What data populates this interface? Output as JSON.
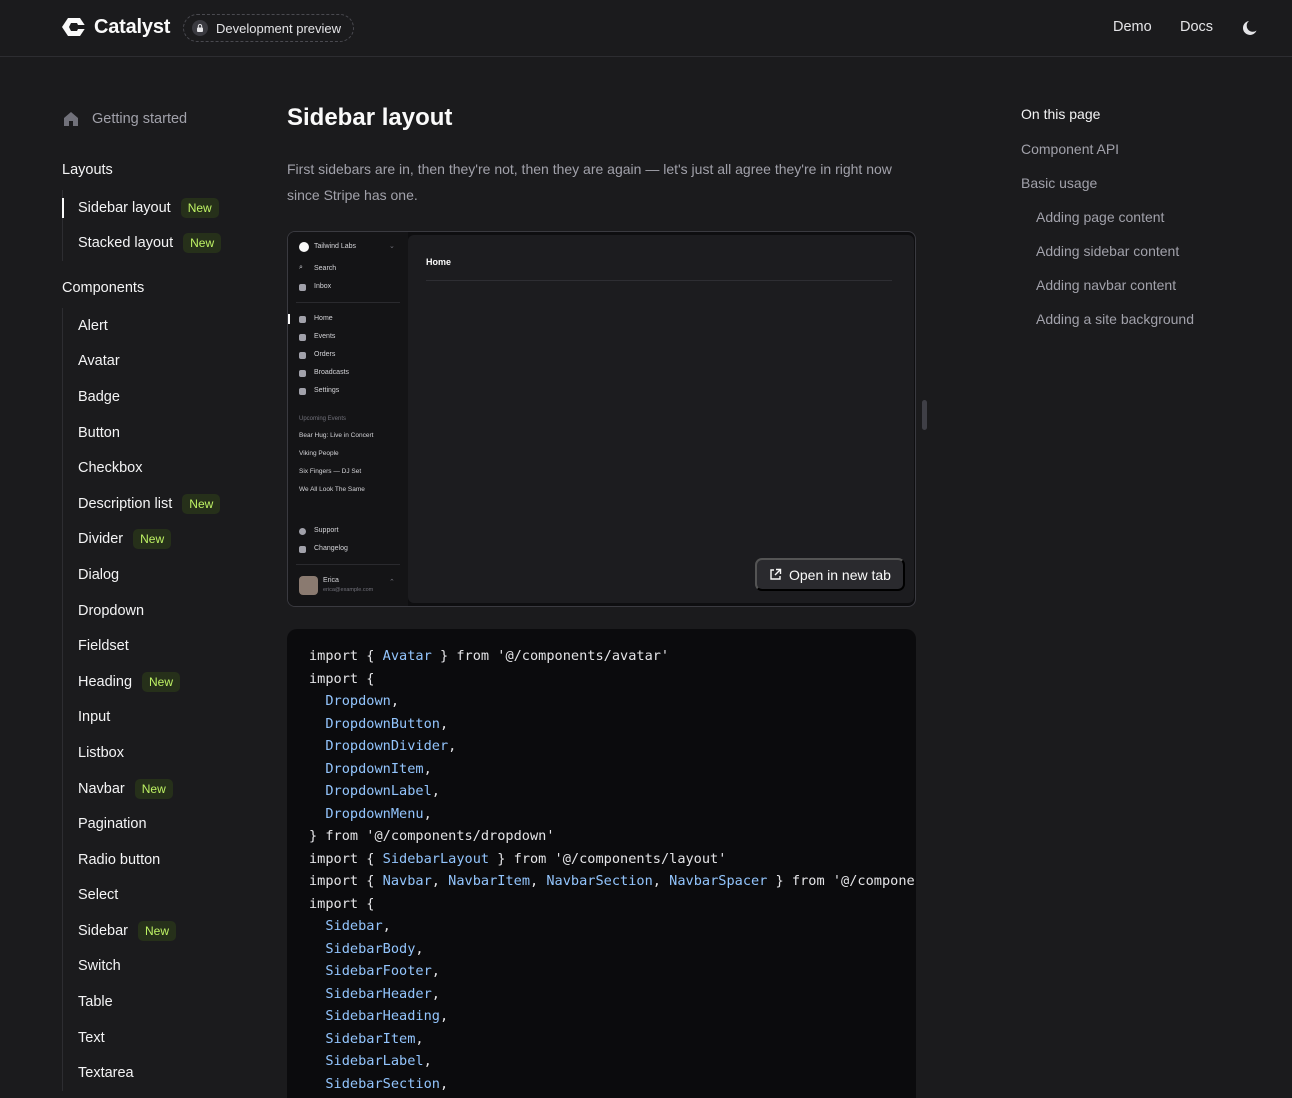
{
  "header": {
    "brand": "Catalyst",
    "pill": "Development preview",
    "links": [
      "Demo",
      "Docs"
    ]
  },
  "sidebar": {
    "getting_started": "Getting started",
    "layouts_heading": "Layouts",
    "layouts": [
      {
        "label": "Sidebar layout",
        "badge": "New"
      },
      {
        "label": "Stacked layout",
        "badge": "New"
      }
    ],
    "components_heading": "Components",
    "components": [
      {
        "label": "Alert",
        "badge": ""
      },
      {
        "label": "Avatar",
        "badge": ""
      },
      {
        "label": "Badge",
        "badge": ""
      },
      {
        "label": "Button",
        "badge": ""
      },
      {
        "label": "Checkbox",
        "badge": ""
      },
      {
        "label": "Description list",
        "badge": "New"
      },
      {
        "label": "Divider",
        "badge": "New"
      },
      {
        "label": "Dialog",
        "badge": ""
      },
      {
        "label": "Dropdown",
        "badge": ""
      },
      {
        "label": "Fieldset",
        "badge": ""
      },
      {
        "label": "Heading",
        "badge": "New"
      },
      {
        "label": "Input",
        "badge": ""
      },
      {
        "label": "Listbox",
        "badge": ""
      },
      {
        "label": "Navbar",
        "badge": "New"
      },
      {
        "label": "Pagination",
        "badge": ""
      },
      {
        "label": "Radio button",
        "badge": ""
      },
      {
        "label": "Select",
        "badge": ""
      },
      {
        "label": "Sidebar",
        "badge": "New"
      },
      {
        "label": "Switch",
        "badge": ""
      },
      {
        "label": "Table",
        "badge": ""
      },
      {
        "label": "Text",
        "badge": ""
      },
      {
        "label": "Textarea",
        "badge": ""
      }
    ]
  },
  "main": {
    "title": "Sidebar layout",
    "lead": "First sidebars are in, then they're not, then they are again — let's just all agree they're in right now since Stripe has one.",
    "open_tab": "Open in new tab"
  },
  "preview": {
    "team": "Tailwind Labs",
    "search": "Search",
    "inbox": "Inbox",
    "nav": [
      "Home",
      "Events",
      "Orders",
      "Broadcasts",
      "Settings"
    ],
    "upcoming_heading": "Upcoming Events",
    "events": [
      "Bear Hug: Live in Concert",
      "Viking People",
      "Six Fingers — DJ Set",
      "We All Look The Same"
    ],
    "support": "Support",
    "changelog": "Changelog",
    "user_name": "Erica",
    "user_email": "erica@example.com",
    "page_heading": "Home"
  },
  "code_lines": [
    [
      [
        "import { ",
        ""
      ],
      [
        "Avatar",
        "i"
      ],
      [
        " } from '@/components/avatar'",
        ""
      ]
    ],
    [
      [
        "import {",
        ""
      ]
    ],
    [
      [
        "  ",
        ""
      ],
      [
        "Dropdown",
        "i"
      ],
      [
        ",",
        ""
      ]
    ],
    [
      [
        "  ",
        ""
      ],
      [
        "DropdownButton",
        "i"
      ],
      [
        ",",
        ""
      ]
    ],
    [
      [
        "  ",
        ""
      ],
      [
        "DropdownDivider",
        "i"
      ],
      [
        ",",
        ""
      ]
    ],
    [
      [
        "  ",
        ""
      ],
      [
        "DropdownItem",
        "i"
      ],
      [
        ",",
        ""
      ]
    ],
    [
      [
        "  ",
        ""
      ],
      [
        "DropdownLabel",
        "i"
      ],
      [
        ",",
        ""
      ]
    ],
    [
      [
        "  ",
        ""
      ],
      [
        "DropdownMenu",
        "i"
      ],
      [
        ",",
        ""
      ]
    ],
    [
      [
        "} from '@/components/dropdown'",
        ""
      ]
    ],
    [
      [
        "import { ",
        ""
      ],
      [
        "SidebarLayout",
        "i"
      ],
      [
        " } from '@/components/layout'",
        ""
      ]
    ],
    [
      [
        "import { ",
        ""
      ],
      [
        "Navbar",
        "i"
      ],
      [
        ", ",
        ""
      ],
      [
        "NavbarItem",
        "i"
      ],
      [
        ", ",
        ""
      ],
      [
        "NavbarSection",
        "i"
      ],
      [
        ", ",
        ""
      ],
      [
        "NavbarSpacer",
        "i"
      ],
      [
        " } from '@/componen",
        ""
      ]
    ],
    [
      [
        "import {",
        ""
      ]
    ],
    [
      [
        "  ",
        ""
      ],
      [
        "Sidebar",
        "i"
      ],
      [
        ",",
        ""
      ]
    ],
    [
      [
        "  ",
        ""
      ],
      [
        "SidebarBody",
        "i"
      ],
      [
        ",",
        ""
      ]
    ],
    [
      [
        "  ",
        ""
      ],
      [
        "SidebarFooter",
        "i"
      ],
      [
        ",",
        ""
      ]
    ],
    [
      [
        "  ",
        ""
      ],
      [
        "SidebarHeader",
        "i"
      ],
      [
        ",",
        ""
      ]
    ],
    [
      [
        "  ",
        ""
      ],
      [
        "SidebarHeading",
        "i"
      ],
      [
        ",",
        ""
      ]
    ],
    [
      [
        "  ",
        ""
      ],
      [
        "SidebarItem",
        "i"
      ],
      [
        ",",
        ""
      ]
    ],
    [
      [
        "  ",
        ""
      ],
      [
        "SidebarLabel",
        "i"
      ],
      [
        ",",
        ""
      ]
    ],
    [
      [
        "  ",
        ""
      ],
      [
        "SidebarSection",
        "i"
      ],
      [
        ",",
        ""
      ]
    ]
  ],
  "toc": {
    "heading": "On this page",
    "items": [
      {
        "label": "Component API",
        "level": 1
      },
      {
        "label": "Basic usage",
        "level": 1
      },
      {
        "label": "Adding page content",
        "level": 2
      },
      {
        "label": "Adding sidebar content",
        "level": 2
      },
      {
        "label": "Adding navbar content",
        "level": 2
      },
      {
        "label": "Adding a site background",
        "level": 2
      }
    ]
  },
  "colors": {
    "background": "#1b1b1d",
    "badge_text": "#bef264",
    "badge_bg": "#26301a",
    "code_ident": "#93c5fd"
  }
}
